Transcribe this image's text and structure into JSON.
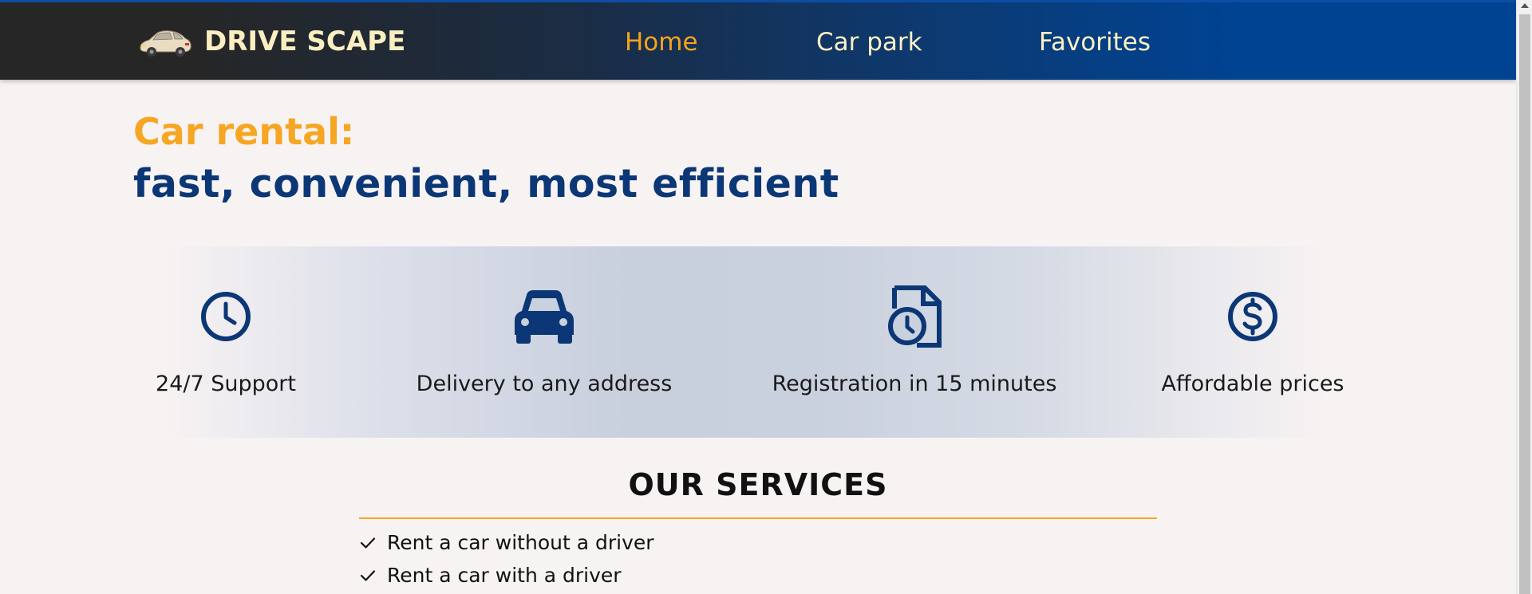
{
  "brand": {
    "logo_icon": "car-logo-icon",
    "name": "DRIVE SCAPE"
  },
  "nav": {
    "items": [
      {
        "label": "Home",
        "active": true
      },
      {
        "label": "Car park",
        "active": false
      },
      {
        "label": "Favorites",
        "active": false
      }
    ]
  },
  "hero": {
    "title": "Car rental:",
    "subtitle": "fast, convenient, most efficient"
  },
  "features": [
    {
      "icon": "clock-icon",
      "label": "24/7 Support"
    },
    {
      "icon": "car-icon",
      "label": "Delivery to any address"
    },
    {
      "icon": "document-clock-icon",
      "label": "Registration in 15 minutes"
    },
    {
      "icon": "dollar-icon",
      "label": "Affordable prices"
    }
  ],
  "services": {
    "title": "OUR SERVICES",
    "items": [
      {
        "icon": "check-icon",
        "label": "Rent a car without a driver"
      },
      {
        "icon": "check-icon",
        "label": "Rent a car with a driver"
      }
    ]
  },
  "colors": {
    "accent_orange": "#f5a623",
    "navy": "#0c3776",
    "brand_cream": "#fbeec1",
    "header_dark": "#262626",
    "header_blue": "#004393",
    "background": "#f8f3f3"
  }
}
